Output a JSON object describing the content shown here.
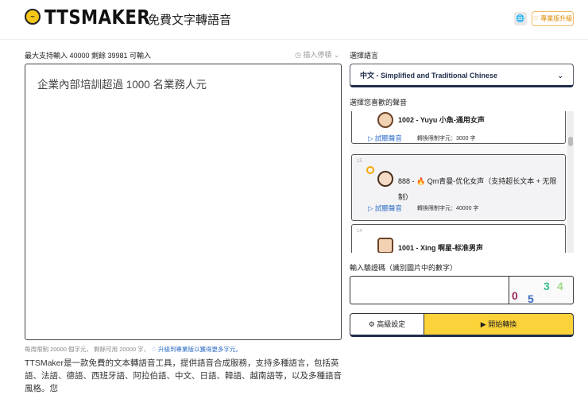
{
  "header": {
    "logo": "TTSMAKER",
    "subtitle": "免費文字轉語音",
    "lang_icon": "🌐",
    "upgrade": "♡ 專業版升級"
  },
  "input": {
    "limit_text": "最大支持輸入 40000 剩餘 39981 可輸入",
    "insert_pause": "插入停頓",
    "text": "企業內部培訓超過 1000 名業務人元"
  },
  "language": {
    "label": "選擇語言",
    "selected": "中文 - Simplified and Traditional Chinese"
  },
  "voice": {
    "label": "選擇您喜歡的聲音",
    "items": [
      {
        "name": "1002 - Yuyu 小魚-通用女声",
        "listen": "試聽聲音",
        "limit": "轉換限制字元：3000 字"
      },
      {
        "index": "15",
        "name": "888 - 🔥 Qm青曼-优化女声（支持超长文本 + 无限制）",
        "listen": "試聽聲音",
        "limit": "轉換限制字元：40000 字"
      },
      {
        "index": "14",
        "name": "1001 - Xing 啊星-标准男声"
      }
    ]
  },
  "captcha": {
    "label": "輸入驗證碼（識別圖片中的數字）",
    "digits": [
      "0",
      "5",
      "3",
      "4"
    ]
  },
  "buttons": {
    "advanced": "高級設定",
    "start": "開始轉換"
  },
  "quota": {
    "text": "每周限制 20000 個字元， 剩餘可用 20000 字，",
    "link": "升級到專業版以獲得更多字元。"
  },
  "description": "TTSMaker是一款免費的文本轉語音工具，提供語音合成服務，支持多種語言，包括英語、法語、德語、西班牙語、阿拉伯語、中文、日語、韓語、越南語等，以及多種語音風格。您"
}
